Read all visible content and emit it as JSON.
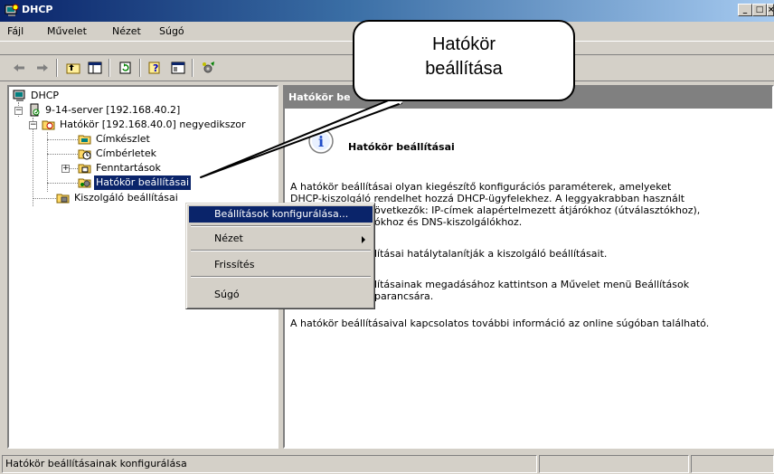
{
  "window": {
    "title": "DHCP",
    "min_label": "_",
    "max_label": "□",
    "close_label": "×"
  },
  "menu": {
    "items": [
      {
        "label": "Fájl",
        "access": "F"
      },
      {
        "label": "Művelet",
        "access": "ű"
      },
      {
        "label": "Nézet",
        "access": "N"
      },
      {
        "label": "Súgó",
        "access": "S"
      }
    ]
  },
  "toolbar": {
    "icons": [
      "back-arrow-icon",
      "forward-arrow-icon",
      "up-folder-icon",
      "show-hide-tree-icon",
      "refresh-icon",
      "help-icon",
      "console-icon",
      "options-icon"
    ]
  },
  "tree": {
    "root": "DHCP",
    "server": "9-14-server [192.168.40.2]",
    "scope": "Hatókör [192.168.40.0] negyedikszor",
    "address_pool": "Címkészlet",
    "leases": "Címbérletek",
    "reservations": "Fenntartások",
    "scope_options": "Hatókör beállításai",
    "server_options": "Kiszolgáló beállításai",
    "expander_minus": "−",
    "expander_plus": "+"
  },
  "right_pane": {
    "header": "Hatókör be",
    "title": "Hatókör beállításai",
    "paragraph1_line1": "A hatókör beállításai olyan kiegészítő konfigurációs paraméterek, amelyeket",
    "paragraph1_line2": "DHCP-kiszolgáló rendelhet hozzá DHCP-ügyfelekhez. A leggyakrabban használt",
    "paragraph1_line3": "övetkezők: IP-címek alapértelmezett átjárókhoz (útválasztókhoz),",
    "paragraph1_line4": "ókhoz és DNS-kiszolgálókhoz.",
    "paragraph2": "lításai hatálytalanítják a kiszolgáló beállításait.",
    "paragraph3_line1": "lításainak megadásához kattintson a Művelet menü Beállítások",
    "paragraph3_line2": "parancsára.",
    "paragraph4": "A hatókör beállításaival kapcsolatos további információ az online súgóban található."
  },
  "context_menu": {
    "configure": "Beállítások konfigurálása...",
    "view": "Nézet",
    "refresh": "Frissítés",
    "help": "Súgó"
  },
  "callout": {
    "line1": "Hatókör",
    "line2": "beállítása"
  },
  "status": {
    "text": "Hatókör beállításainak konfigurálása"
  },
  "colors": {
    "titlebar_start": "#0a246a",
    "titlebar_end": "#a6caf0",
    "selection": "#0a246a",
    "face": "#d4d0c8",
    "pane_header": "#808080"
  }
}
